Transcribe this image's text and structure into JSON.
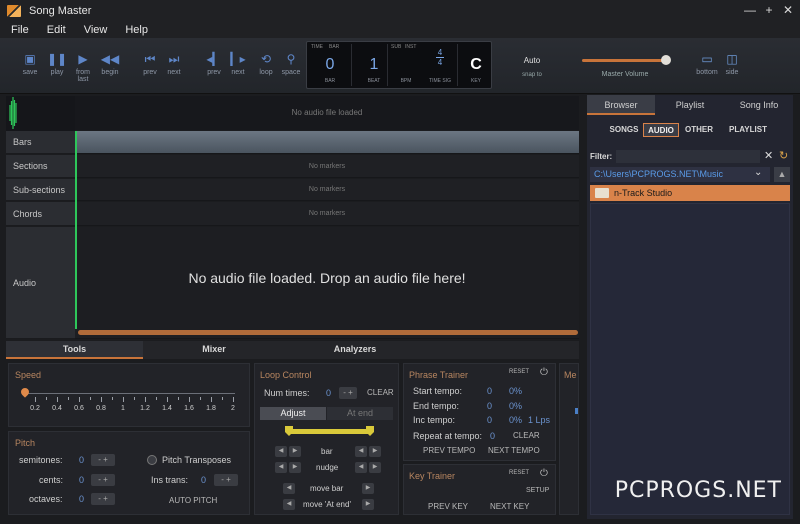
{
  "window": {
    "title": "Song Master",
    "minimize": "—",
    "maximize": "+",
    "close": "✕"
  },
  "menu": [
    "File",
    "Edit",
    "View",
    "Help"
  ],
  "toolbar": {
    "buttons": [
      {
        "name": "save",
        "label": "save",
        "icon": "save-icon"
      },
      {
        "name": "play",
        "label": "play",
        "icon": "pause-icon"
      },
      {
        "name": "from-last",
        "label": "from last",
        "icon": "play-from-last-icon"
      },
      {
        "name": "begin",
        "label": "begin",
        "icon": "rewind-icon"
      },
      {
        "name": "prev",
        "label": "prev",
        "icon": "skip-back-icon"
      },
      {
        "name": "next",
        "label": "next",
        "icon": "skip-forward-icon"
      },
      {
        "name": "prev2",
        "label": "prev",
        "icon": "prev-marker-icon"
      },
      {
        "name": "next2",
        "label": "next",
        "icon": "next-marker-icon"
      },
      {
        "name": "loop",
        "label": "loop",
        "icon": "loop-icon"
      },
      {
        "name": "space",
        "label": "space",
        "icon": "pin-icon"
      }
    ],
    "counter": {
      "heads": [
        "TIME",
        "BAR",
        "SUB",
        "INST"
      ],
      "bar": "0",
      "beat": "1",
      "bpm": "",
      "time_sig_top": "4",
      "time_sig_bottom": "4",
      "key": "C",
      "labels": [
        "BAR",
        "BEAT",
        "BPM",
        "TIME SIG",
        "KEY"
      ]
    },
    "snap_value": "Auto",
    "snap_label": "snap to",
    "master_volume_label": "Master Volume",
    "master_volume_level": 0.94,
    "view_buttons": [
      {
        "label": "bottom",
        "icon": "bottom-panel-icon"
      },
      {
        "label": "side",
        "icon": "side-panel-icon"
      }
    ]
  },
  "timeline": {
    "top_msg": "No audio file loaded",
    "tracks": [
      {
        "label": "Bars",
        "msg": ""
      },
      {
        "label": "Sections",
        "msg": "No markers"
      },
      {
        "label": "Sub-sections",
        "msg": "No markers"
      },
      {
        "label": "Chords",
        "msg": "No markers"
      },
      {
        "label": "Audio",
        "msg": ""
      }
    ],
    "drop_msg": "No audio file loaded. Drop an audio file here!"
  },
  "bottom_tabs": [
    "Tools",
    "Mixer",
    "Analyzers"
  ],
  "speed": {
    "title": "Speed",
    "ticks": [
      "0.2",
      "0.4",
      "0.6",
      "0.8",
      "1",
      "1.2",
      "1.4",
      "1.6",
      "1.8",
      "2"
    ]
  },
  "pitch": {
    "title": "Pitch",
    "semitones": "semitones:",
    "cents": "cents:",
    "octaves": "octaves:",
    "semitones_val": "0",
    "cents_val": "0",
    "octaves_val": "0",
    "transposes": "Pitch Transposes",
    "ins_trans": "Ins trans:",
    "ins_trans_val": "0",
    "auto_pitch": "AUTO PITCH",
    "spin": "- +"
  },
  "loop": {
    "title": "Loop Control",
    "num_times": "Num times:",
    "num_times_val": "0",
    "clear": "CLEAR",
    "adjust": "Adjust",
    "at_end": "At end",
    "bar": "bar",
    "nudge": "nudge",
    "move_bar": "move bar",
    "move_at_end": "move 'At end'"
  },
  "phrase": {
    "title": "Phrase Trainer",
    "reset": "RESET",
    "rows": [
      {
        "label": "Start tempo:",
        "val": "0",
        "pct": "0%",
        "extra": ""
      },
      {
        "label": "End tempo:",
        "val": "0",
        "pct": "0%",
        "extra": ""
      },
      {
        "label": "Inc tempo:",
        "val": "0",
        "pct": "0%",
        "extra": "1 Lps"
      }
    ],
    "repeat": "Repeat at tempo:",
    "repeat_val": "0",
    "clear": "CLEAR",
    "prev_tempo": "PREV TEMPO",
    "next_tempo": "NEXT TEMPO"
  },
  "key_trainer": {
    "title": "Key Trainer",
    "reset": "RESET",
    "setup": "SETUP",
    "prev_key": "PREV KEY",
    "next_key": "NEXT KEY"
  },
  "metronome_stub": "Me",
  "browser": {
    "tabs": [
      "Browser",
      "Playlist",
      "Song Info"
    ],
    "subtabs": [
      "SONGS",
      "AUDIO",
      "OTHER",
      "PLAYLIST"
    ],
    "filter_label": "Filter:",
    "path": "C:\\Users\\PCPROGS.NET\\Music",
    "items": [
      "n-Track Studio"
    ]
  },
  "watermark": "PCPROGS.NET",
  "colors": {
    "accent": "#c8743a",
    "selected": "#d9834a",
    "blue_text": "#6b93cf",
    "play_head": "#2ec65a"
  }
}
